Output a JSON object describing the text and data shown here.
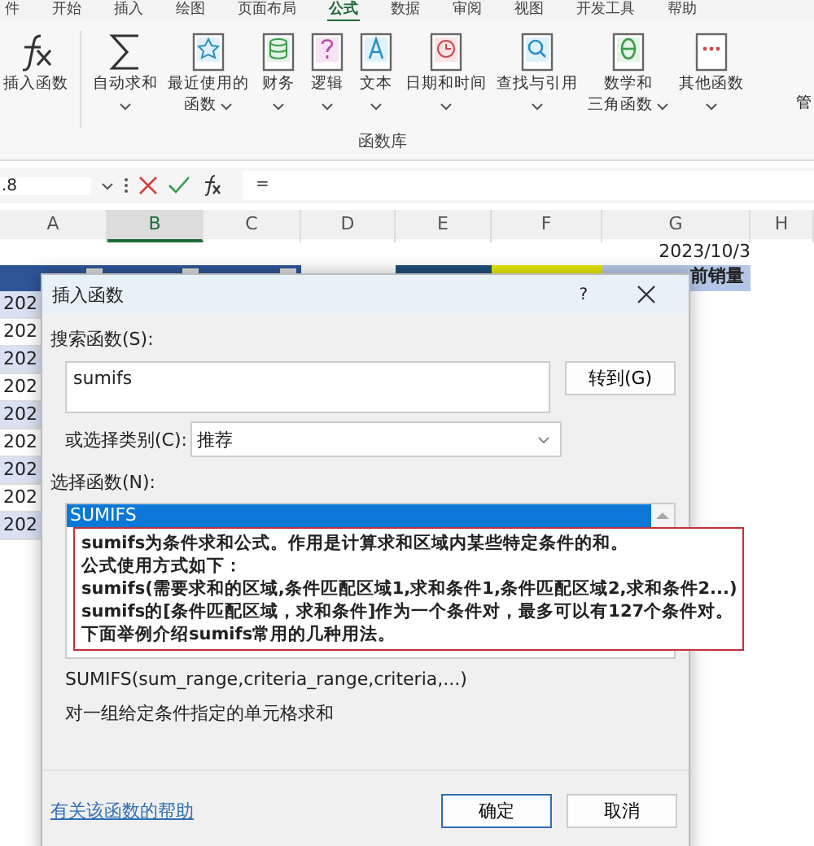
{
  "menu_tabs": [
    {
      "label": "件",
      "selected": false
    },
    {
      "label": "开始",
      "selected": false
    },
    {
      "label": "插入",
      "selected": false
    },
    {
      "label": "绘图",
      "selected": false
    },
    {
      "label": "页面布局",
      "selected": false
    },
    {
      "label": "公式",
      "selected": true
    },
    {
      "label": "数据",
      "selected": false
    },
    {
      "label": "审阅",
      "selected": false
    },
    {
      "label": "视图",
      "selected": false
    },
    {
      "label": "开发工具",
      "selected": false
    },
    {
      "label": "帮助",
      "selected": false
    }
  ],
  "ribbon": {
    "buttons": [
      {
        "kind": "fx",
        "label": "插入函数",
        "dropdown": false
      },
      {
        "kind": "sum",
        "label": "自动求和",
        "dropdown": true
      },
      {
        "kind": "star",
        "label": "最近使用的",
        "label_2": "函数",
        "dropdown": true
      },
      {
        "kind": "db",
        "label": "财务",
        "dropdown": true
      },
      {
        "kind": "question",
        "label": "逻辑",
        "dropdown": true
      },
      {
        "kind": "letter",
        "label": "文本",
        "dropdown": true
      },
      {
        "kind": "clock",
        "label": "日期和时间",
        "dropdown": true
      },
      {
        "kind": "magnifier",
        "label": "查找与引用",
        "dropdown": true
      },
      {
        "kind": "theta",
        "label": "数学和",
        "label_2": "三角函数",
        "dropdown": true
      },
      {
        "kind": "dots",
        "label": "其他函数",
        "dropdown": true
      }
    ],
    "group_label": "函数库",
    "cut_label": "管"
  },
  "formula_bar": {
    "name_box": ".8",
    "formula": "="
  },
  "columns": [
    {
      "label": "A",
      "selected": false
    },
    {
      "label": "B",
      "selected": true
    },
    {
      "label": "C",
      "selected": false
    },
    {
      "label": "D",
      "selected": false
    },
    {
      "label": "E",
      "selected": false
    },
    {
      "label": "F",
      "selected": false
    },
    {
      "label": "G",
      "selected": false
    },
    {
      "label": "H",
      "selected": false
    }
  ],
  "sheet": {
    "date": "2023/10/3",
    "header_cells": [
      {
        "color": "#2f5597",
        "text": "",
        "filter": true
      },
      {
        "color": "#2f5597",
        "text": "",
        "filter": true
      },
      {
        "color": "#2f5597",
        "text": "",
        "filter": true
      },
      {
        "color": "#1f4e79",
        "text": "",
        "filter": false
      },
      {
        "color": "#e6e600",
        "text": "",
        "filter": false
      },
      {
        "color": "#b4c6e7",
        "text": "前销量",
        "filter": false
      }
    ],
    "row_labels": [
      "202",
      "202",
      "202",
      "202",
      "202",
      "202",
      "202",
      "202",
      "202"
    ]
  },
  "dialog": {
    "title": "插入函数",
    "help": "?",
    "search_label": "搜索函数(S):",
    "search_value": "sumifs",
    "go_button": "转到(G)",
    "category_label": "或选择类别(C):",
    "category_value": "推荐",
    "list_label": "选择函数(N):",
    "functions": [
      {
        "name": "SUMIFS",
        "selected": true
      }
    ],
    "annotation": [
      "sumifs为条件求和公式。作用是计算求和区域内某些特定条件的和。",
      "公式使用方式如下：",
      "sumifs(需要求和的区域,条件匹配区域1,求和条件1,条件匹配区域2,求和条件2...)",
      "sumifs的[条件匹配区域，求和条件]作为一个条件对，最多可以有127个条件对。",
      "下面举例介绍sumifs常用的几种用法。"
    ],
    "signature": "SUMIFS(sum_range,criteria_range,criteria,...)",
    "description": "对一组给定条件指定的单元格求和",
    "help_link": "有关该函数的帮助",
    "buttons": [
      {
        "label": "确定",
        "default": true
      },
      {
        "label": "取消",
        "default": false
      }
    ]
  }
}
